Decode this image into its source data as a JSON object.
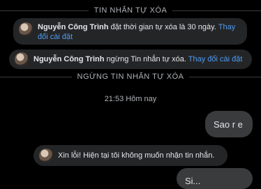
{
  "dividers": {
    "top": "TIN NHẮN TỰ XÓA",
    "middle": "NGỪNG TIN NHẮN TỰ XÓA"
  },
  "system_messages": [
    {
      "name": "Nguyễn Công Trình",
      "text": " đặt thời gian tự xóa là 30 ngày. ",
      "link": "Thay đổi cài đặt"
    },
    {
      "name": "Nguyễn Công Trình",
      "text": " ngừng Tin nhắn tự xóa. ",
      "link": "Thay đổi cài đặt"
    }
  ],
  "timestamp": "21:53 Hôm nay",
  "messages": {
    "outgoing_1": "Sao r e",
    "incoming_1": "Xin lỗi! Hiện tại tôi không muốn nhận tin nhắn.",
    "outgoing_2": "Si..."
  }
}
